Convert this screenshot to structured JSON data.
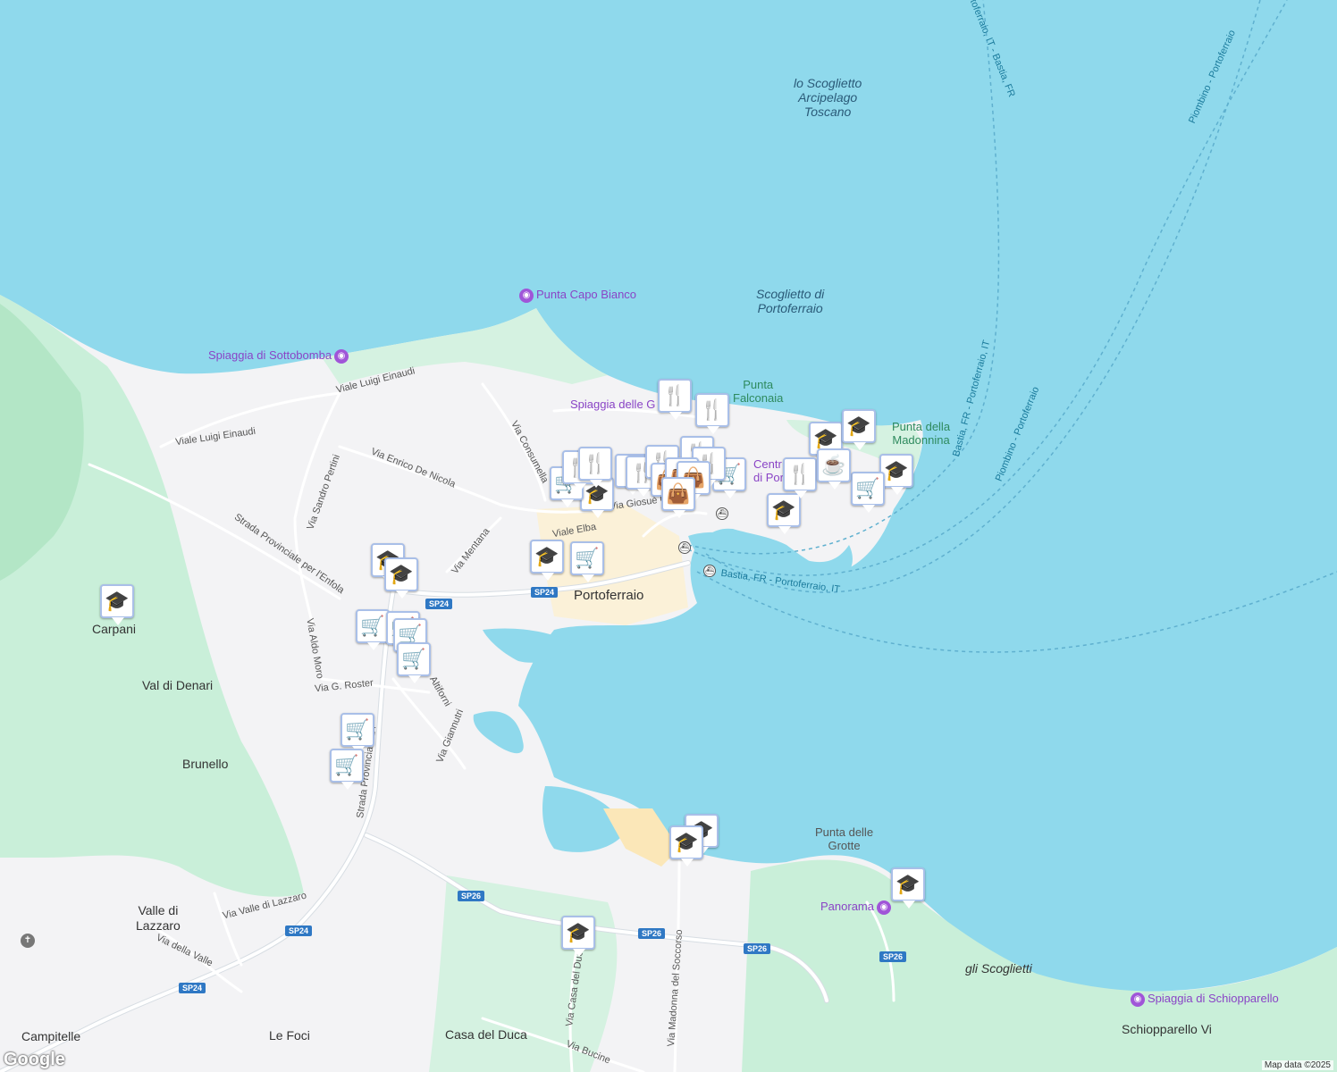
{
  "map": {
    "attribution": "Map data ©2025",
    "logo": "Google",
    "places": {
      "portoferraio": "Portoferraio",
      "carpani": "Carpani",
      "val_di_denari": "Val di Denari",
      "brunello": "Brunello",
      "valle_di_lazzaro": "Valle di\nLazzaro",
      "le_foci": "Le Foci",
      "casa_del_duca": "Casa del Duca",
      "campitelle": "Campitelle",
      "schiopparello": "Schiopparello Vi",
      "gli_scoglietti": "gli Scoglietti"
    },
    "sea_labels": {
      "lo_scoglietto": "lo Scoglietto\nArcipelago\nToscano",
      "scoglietto_di_portoferraio": "Scoglietto di\nPortoferraio"
    },
    "natural_labels": {
      "punta_falconaia": "Punta\nFalconaia",
      "punta_della_madonnina": "Punta della\nMadonnina",
      "punta_delle_grotte": "Punta delle\nGrotte"
    },
    "pois": {
      "punta_capo_bianco": "Punta Capo Bianco",
      "spiaggia_di_sottobomba": "Spiaggia di Sottobomba",
      "spiaggia_delle_ghiaie": "Spiaggia delle G",
      "centro": "Centr",
      "centro2": "di Por",
      "panorama": "Panorama",
      "spiaggia_di_schiopparello": "Spiaggia di Schiopparello"
    },
    "streets": {
      "viale_luigi_einaudi_1": "Viale Luigi Einaudi",
      "viale_luigi_einaudi_2": "Viale Luigi Einaudi",
      "via_sandro_pertini": "Via Sandro Pertini",
      "via_enrico_de_nicola": "Via Enrico De Nicola",
      "via_consumella": "Via Consumella",
      "strada_provinciale_enfola": "Strada Provinciale per l'Enfola",
      "via_mentana": "Via Mentana",
      "viale_elba": "Viale Elba",
      "via_giosue": "Via Giosuè C",
      "via_aldo_moro": "Via Aldo Moro",
      "via_g_roster": "Via G. Roster",
      "altiforni": "Altiforni",
      "via_giannutri": "Via Giannutri",
      "strada_provinciale_24": "Strada Provinciale 24",
      "via_valle_di_lazzaro": "Via Valle di Lazzaro",
      "via_della_valle": "Via della Valle",
      "via_casa_del_duca": "Via Casa del Duca",
      "via_madonna_del_soccorso": "Via Madonna del Soccorso",
      "via_bucine": "Via Bucine"
    },
    "ferry_routes": {
      "bastia_1": "Bastia, FR - Portoferraio, IT",
      "bastia_2": "Bastia, FR - Portoferraio, IT",
      "bastia_3": "Bastia, FR - Portoferraio, IT",
      "portoferraio_it_top": "Portoferraio, IT - Bastia, FR",
      "piombino_1": "Piombino - Portoferraio",
      "piombino_2": "Piombino - Portoferraio"
    },
    "road_shields": {
      "sp24_a": "SP24",
      "sp24_b": "SP24",
      "sp24_c": "SP24",
      "sp24_d": "SP24",
      "sp26_a": "SP26",
      "sp26_b": "SP26",
      "sp26_c": "SP26",
      "sp26_d": "SP26"
    },
    "marker_types": [
      "school-icon",
      "shopping-cart-icon",
      "restaurant-icon",
      "shopping-bag-icon",
      "cafe-icon"
    ]
  }
}
